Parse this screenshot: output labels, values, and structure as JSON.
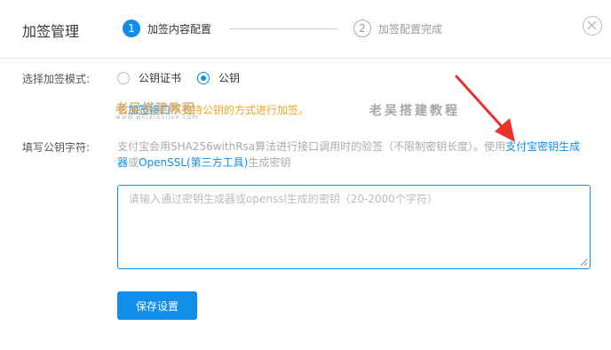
{
  "header": {
    "title": "加签管理",
    "steps": [
      {
        "number": "1",
        "label": "加签内容配置",
        "active": true
      },
      {
        "number": "2",
        "label": "加签配置完成",
        "active": false
      }
    ],
    "close_icon": "close-circle-icon"
  },
  "mode": {
    "label": "选择加签模式:",
    "options": [
      {
        "label": "公钥证书",
        "selected": false
      },
      {
        "label": "公钥",
        "selected": true
      }
    ]
  },
  "notice": {
    "prefix": "该",
    "link": "加签接口",
    "warning": "不支持公钥的方式进行加签。"
  },
  "watermark": {
    "left": "老吴搭建教程",
    "right": "老吴搭建教程",
    "url": "www.weixiaolive.com"
  },
  "public_key": {
    "label": "填写公钥字符:",
    "desc_text": "支付宝会用SHA256withRsa算法进行接口调用时的验签（不限制密钥长度）。使用",
    "link1": "支付宝密钥生成器",
    "or": "或",
    "link2": "OpenSSL(第三方工具)",
    "suffix": "生成密钥",
    "placeholder": "请输入通过密钥生成器或openssl生成的密钥（20-2000个字符）",
    "value": ""
  },
  "actions": {
    "save_label": "保存设置"
  },
  "colors": {
    "primary": "#108ee9",
    "warning": "#f5a623",
    "annotation_arrow": "#e8322d"
  }
}
